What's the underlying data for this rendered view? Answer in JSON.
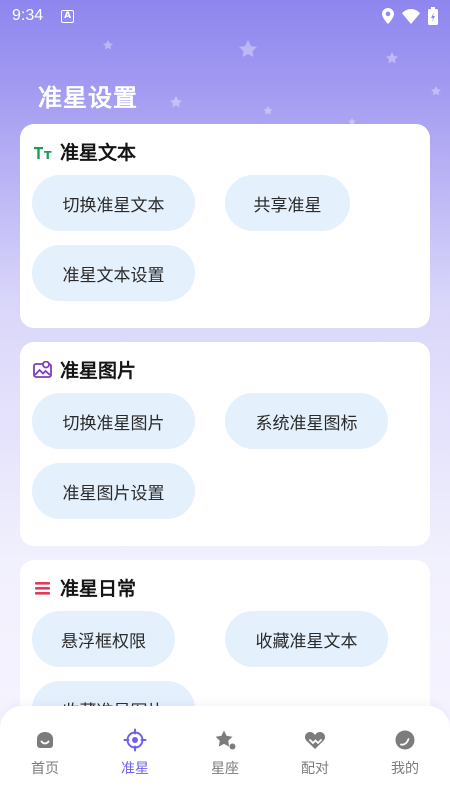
{
  "status_bar": {
    "time": "9:34",
    "notification_badge": "A"
  },
  "page": {
    "title": "准星设置"
  },
  "sections": [
    {
      "title": "准星文本",
      "icon": "text-size-icon",
      "icon_color": "#1e9e55",
      "buttons": [
        "切换准星文本",
        "共享准星",
        "准星文本设置"
      ]
    },
    {
      "title": "准星图片",
      "icon": "image-icon",
      "icon_color": "#7b3fb8",
      "buttons": [
        "切换准星图片",
        "系统准星图标",
        "准星图片设置"
      ]
    },
    {
      "title": "准星日常",
      "icon": "list-icon",
      "icon_color": "#e23a58",
      "buttons": [
        "悬浮框权限",
        "收藏准星文本",
        "收藏准星图片"
      ]
    }
  ],
  "nav": [
    {
      "label": "首页",
      "icon": "home-icon",
      "active": false
    },
    {
      "label": "准星",
      "icon": "crosshair-icon",
      "active": true
    },
    {
      "label": "星座",
      "icon": "constellation-icon",
      "active": false
    },
    {
      "label": "配对",
      "icon": "pair-heart-icon",
      "active": false
    },
    {
      "label": "我的",
      "icon": "profile-icon",
      "active": false
    }
  ],
  "colors": {
    "accent": "#6c63e8",
    "pill_bg": "#e4f0fc",
    "header_bg": "#8e86ee"
  }
}
